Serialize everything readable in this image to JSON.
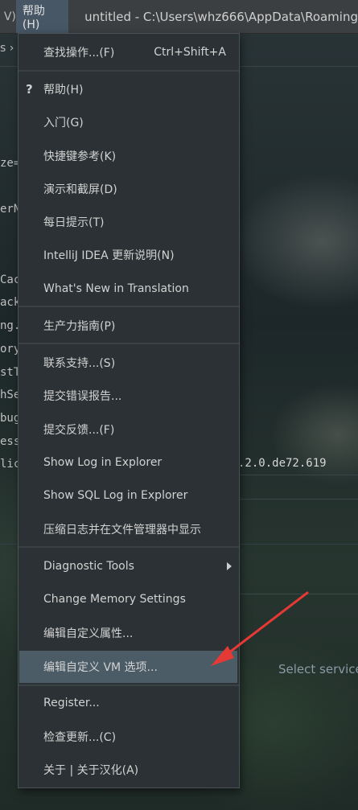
{
  "titlebar": {
    "menu_partial": "V)",
    "help_menu": "帮助(H)",
    "window_title": "untitled - C:\\Users\\whz666\\AppData\\Roaming"
  },
  "editor": {
    "breadcrumb_chevron": "s ›",
    "fragments": [
      "ze=",
      "erN",
      "Cac",
      "ack",
      "ng.",
      "ory",
      "stT",
      "hSe",
      "bug",
      "ess",
      "lic"
    ],
    "version": ".2.0.de72.619",
    "select_service": "Select service"
  },
  "menu": {
    "items": [
      {
        "label": "查找操作...(F)",
        "shortcut": "Ctrl+Shift+A"
      },
      {
        "label": "帮助(H)",
        "icon": "help-question-icon"
      },
      {
        "label": "入门(G)"
      },
      {
        "label": "快捷键参考(K)"
      },
      {
        "label": "演示和截屏(D)"
      },
      {
        "label": "每日提示(T)"
      },
      {
        "label": "IntelliJ IDEA 更新说明(N)"
      },
      {
        "label": "What's New in Translation"
      },
      {
        "label": "生产力指南(P)"
      },
      {
        "label": "联系支持...(S)"
      },
      {
        "label": "提交错误报告..."
      },
      {
        "label": "提交反馈...(F)"
      },
      {
        "label": "Show Log in Explorer"
      },
      {
        "label": "Show SQL Log in Explorer"
      },
      {
        "label": "压缩日志并在文件管理器中显示"
      },
      {
        "label": "Diagnostic Tools",
        "submenu": true
      },
      {
        "label": "Change Memory Settings"
      },
      {
        "label": "编辑自定义属性..."
      },
      {
        "label": "编辑自定义 VM 选项...",
        "selected": true
      },
      {
        "label": "Register..."
      },
      {
        "label": "检查更新...(C)"
      },
      {
        "label": "关于 | 关于汉化(A)"
      }
    ]
  },
  "annotation": {
    "color": "#e53935",
    "icon": "red-arrow-annotation"
  }
}
